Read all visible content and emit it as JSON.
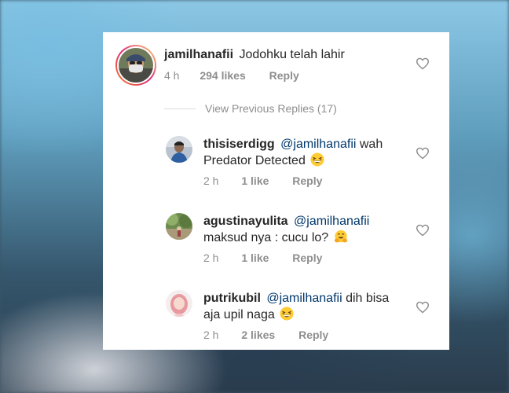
{
  "main_comment": {
    "username": "jamilhanafii",
    "text": "Jodohku telah lahir",
    "time": "4 h",
    "likes": "294 likes",
    "reply": "Reply"
  },
  "view_previous": "View Previous Replies (17)",
  "replies": [
    {
      "username": "thisiserdigg",
      "mention": "@jamilhanafii",
      "text_line1": "wah",
      "text_line2": "Predator Detected",
      "emoji": "grinning-squint-emoji",
      "time": "2 h",
      "likes": "1 like",
      "reply": "Reply"
    },
    {
      "username": "agustinayulita",
      "mention": "@jamilhanafii",
      "text_line1": "",
      "text_line2": "maksud nya : cucu lo?",
      "emoji": "hugging-emoji",
      "time": "2 h",
      "likes": "1 like",
      "reply": "Reply"
    },
    {
      "username": "putrikubil",
      "mention": "@jamilhanafii",
      "text_line1": "dih bisa",
      "text_line2": "aja upil naga",
      "emoji": "grinning-squint-emoji",
      "time": "2 h",
      "likes": "2 likes",
      "reply": "Reply"
    }
  ],
  "icons": {
    "like": "heart-outline-icon"
  },
  "colors": {
    "text": "#262626",
    "meta": "#8e8e8e",
    "mention": "#00376b",
    "story_ring_start": "#f58529",
    "story_ring_end": "#dd2a7b"
  }
}
